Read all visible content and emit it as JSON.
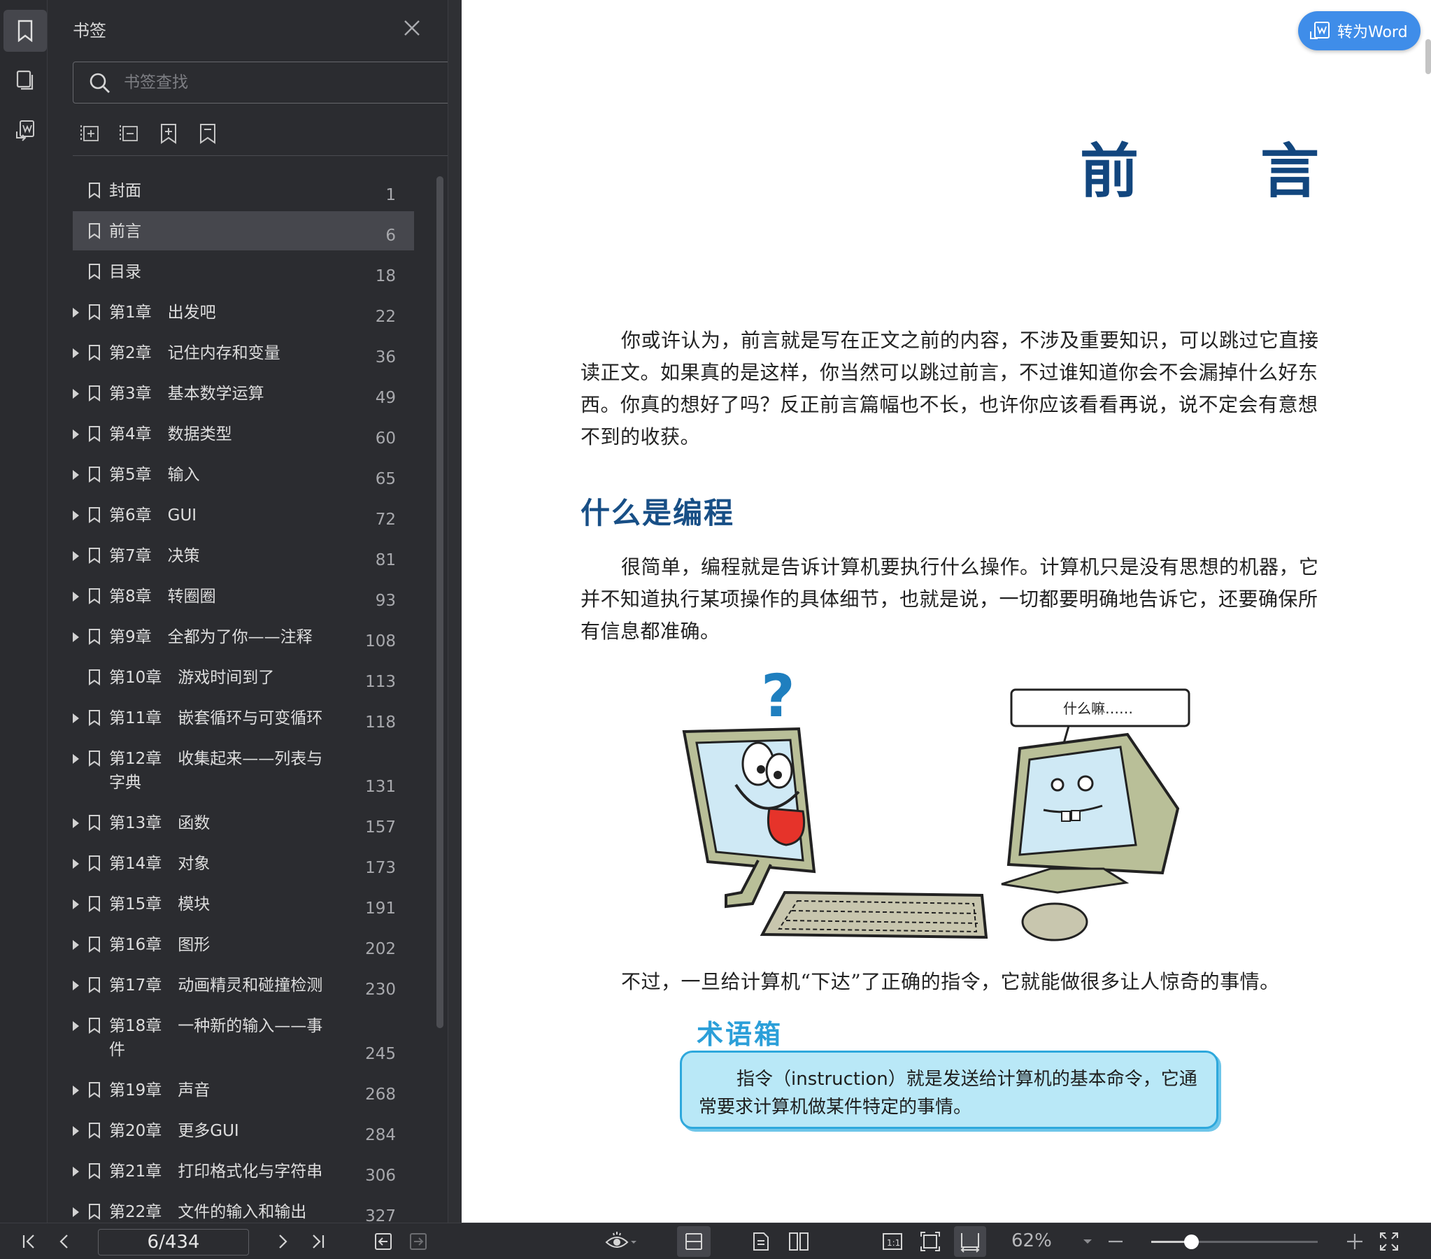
{
  "panel": {
    "title": "书签",
    "search_placeholder": "书签查找"
  },
  "bookmarks": [
    {
      "label": "封面",
      "page": "1",
      "expandable": false,
      "selected": false
    },
    {
      "label": "前言",
      "page": "6",
      "expandable": false,
      "selected": true
    },
    {
      "label": "目录",
      "page": "18",
      "expandable": false,
      "selected": false
    },
    {
      "label": "第1章　出发吧",
      "page": "22",
      "expandable": true,
      "selected": false
    },
    {
      "label": "第2章　记住内存和变量",
      "page": "36",
      "expandable": true,
      "selected": false
    },
    {
      "label": "第3章　基本数学运算",
      "page": "49",
      "expandable": true,
      "selected": false
    },
    {
      "label": "第4章　数据类型",
      "page": "60",
      "expandable": true,
      "selected": false
    },
    {
      "label": "第5章　输入",
      "page": "65",
      "expandable": true,
      "selected": false
    },
    {
      "label": "第6章　GUI",
      "page": "72",
      "expandable": true,
      "selected": false
    },
    {
      "label": "第7章　决策",
      "page": "81",
      "expandable": true,
      "selected": false
    },
    {
      "label": "第8章　转圈圈",
      "page": "93",
      "expandable": true,
      "selected": false
    },
    {
      "label": "第9章　全都为了你——注释",
      "page": "108",
      "expandable": true,
      "selected": false
    },
    {
      "label": "第10章　游戏时间到了",
      "page": "113",
      "expandable": false,
      "selected": false
    },
    {
      "label": "第11章　嵌套循环与可变循环",
      "page": "118",
      "expandable": true,
      "selected": false
    },
    {
      "label": "第12章　收集起来——列表与\n字典",
      "page": "131",
      "expandable": true,
      "selected": false
    },
    {
      "label": "第13章　函数",
      "page": "157",
      "expandable": true,
      "selected": false
    },
    {
      "label": "第14章　对象",
      "page": "173",
      "expandable": true,
      "selected": false
    },
    {
      "label": "第15章　模块",
      "page": "191",
      "expandable": true,
      "selected": false
    },
    {
      "label": "第16章　图形",
      "page": "202",
      "expandable": true,
      "selected": false
    },
    {
      "label": "第17章　动画精灵和碰撞检测",
      "page": "230",
      "expandable": true,
      "selected": false
    },
    {
      "label": "第18章　一种新的输入——事\n件",
      "page": "245",
      "expandable": true,
      "selected": false
    },
    {
      "label": "第19章　声音",
      "page": "268",
      "expandable": true,
      "selected": false
    },
    {
      "label": "第20章　更多GUI",
      "page": "284",
      "expandable": true,
      "selected": false
    },
    {
      "label": "第21章　打印格式化与字符串",
      "page": "306",
      "expandable": true,
      "selected": false
    },
    {
      "label": "第22章　文件的输入和输出",
      "page": "327",
      "expandable": true,
      "selected": false
    }
  ],
  "viewer": {
    "convert_button": "转为Word"
  },
  "document": {
    "heading_left": "前",
    "heading_right": "言",
    "para1": "你或许认为，前言就是写在正文之前的内容，不涉及重要知识，可以跳过它直接读正文。如果真的是这样，你当然可以跳过前言，不过谁知道你会不会漏掉什么好东西。你真的想好了吗？反正前言篇幅也不长，也许你应该看看再说，说不定会有意想不到的收获。",
    "section_title": "什么是编程",
    "para2": "很简单，编程就是告诉计算机要执行什么操作。计算机只是没有思想的机器，它并不知道执行某项操作的具体细节，也就是说，一切都要明确地告诉它，还要确保所有信息都准确。",
    "speech_bubble": "什么嘛……",
    "para3": "不过，一旦给计算机“下达”了正确的指令，它就能做很多让人惊奇的事情。",
    "glossary_title": "术语箱",
    "glossary_text": "指令（instruction）就是发送给计算机的基本命令，它通常要求计算机做某件特定的事情。"
  },
  "toolbar": {
    "page_indicator": "6/434",
    "zoom": "62%",
    "zoom_fraction": 0.24
  }
}
